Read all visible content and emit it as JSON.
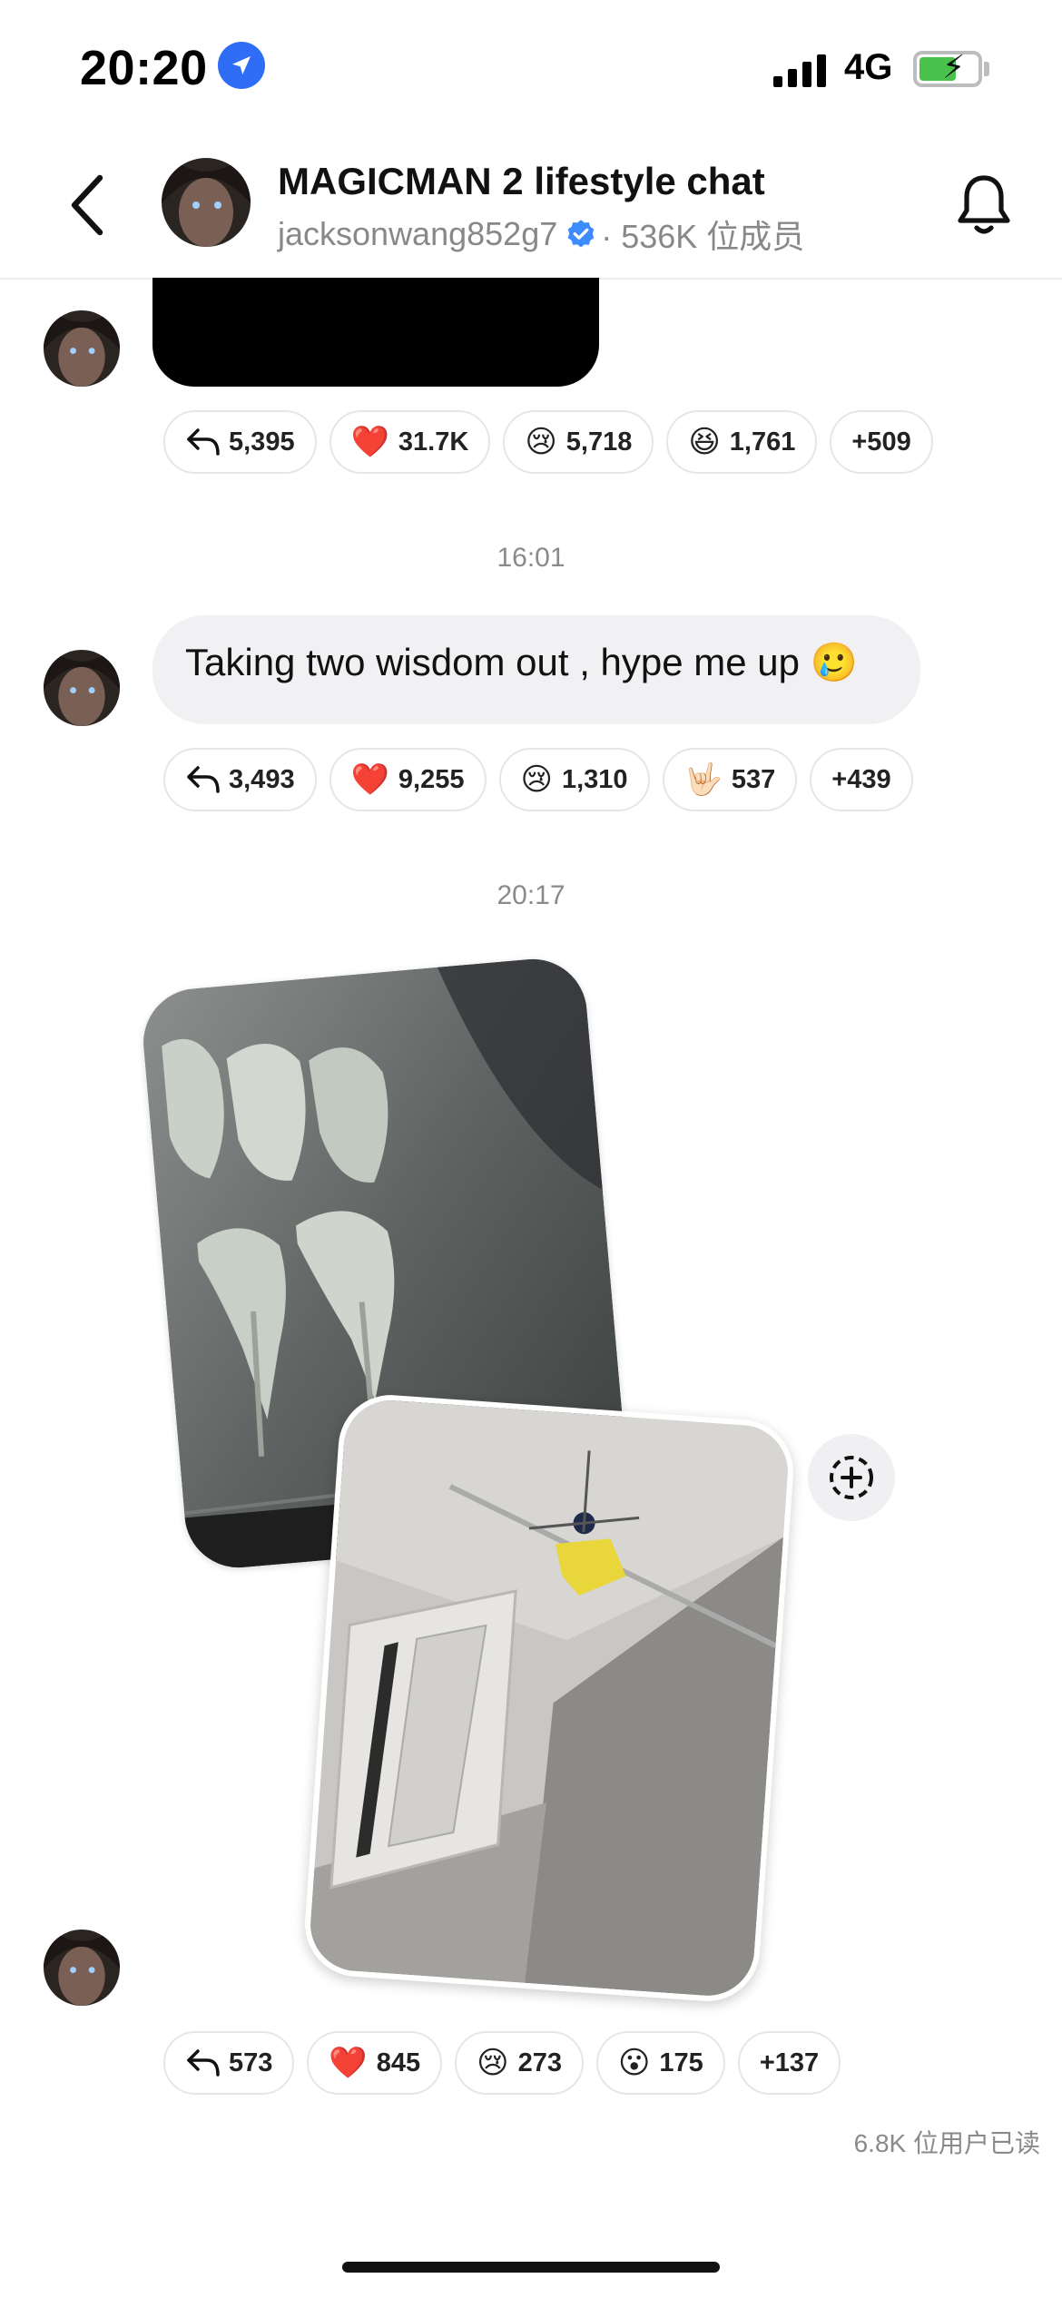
{
  "status_bar": {
    "time": "20:20",
    "network": "4G",
    "location_icon": "location-arrow-icon",
    "battery_icon": "battery-charging-icon"
  },
  "header": {
    "title": "MAGICMAN 2 lifestyle chat",
    "username": "jacksonwang852g7",
    "member_count": "· 536K 位成员",
    "back_icon": "chevron-left-icon",
    "bell_icon": "bell-icon"
  },
  "messages": [
    {
      "type": "media-black",
      "reactions": [
        {
          "icon": "reply-icon",
          "emoji": "",
          "count": "5,395"
        },
        {
          "icon": "heart-emoji",
          "emoji": "❤️",
          "count": "31.7K"
        },
        {
          "icon": "crying-emoji",
          "emoji": "😢",
          "count": "5,718"
        },
        {
          "icon": "laughing-emoji",
          "emoji": "😆",
          "count": "1,761"
        },
        {
          "icon": "",
          "emoji": "",
          "count": "+509"
        }
      ]
    },
    {
      "type": "text",
      "time": "16:01",
      "text": "Taking two wisdom out , hype me up 🥲",
      "reactions": [
        {
          "icon": "reply-icon",
          "emoji": "",
          "count": "3,493"
        },
        {
          "icon": "heart-emoji",
          "emoji": "❤️",
          "count": "9,255"
        },
        {
          "icon": "crying-emoji",
          "emoji": "😢",
          "count": "1,310"
        },
        {
          "icon": "rock-on-emoji",
          "emoji": "🤟🏻",
          "count": "537"
        },
        {
          "icon": "",
          "emoji": "",
          "count": "+439"
        }
      ]
    },
    {
      "type": "photos",
      "time": "20:17",
      "reactions": [
        {
          "icon": "reply-icon",
          "emoji": "",
          "count": "573"
        },
        {
          "icon": "heart-emoji",
          "emoji": "❤️",
          "count": "845"
        },
        {
          "icon": "crying-emoji",
          "emoji": "😢",
          "count": "273"
        },
        {
          "icon": "surprised-emoji",
          "emoji": "😮",
          "count": "175"
        },
        {
          "icon": "",
          "emoji": "",
          "count": "+137"
        }
      ]
    }
  ],
  "read_receipt": "6.8K 位用户已读",
  "colors": {
    "accent": "#2f6df6",
    "bubble": "#f1f1f4",
    "battery": "#48c24b"
  }
}
